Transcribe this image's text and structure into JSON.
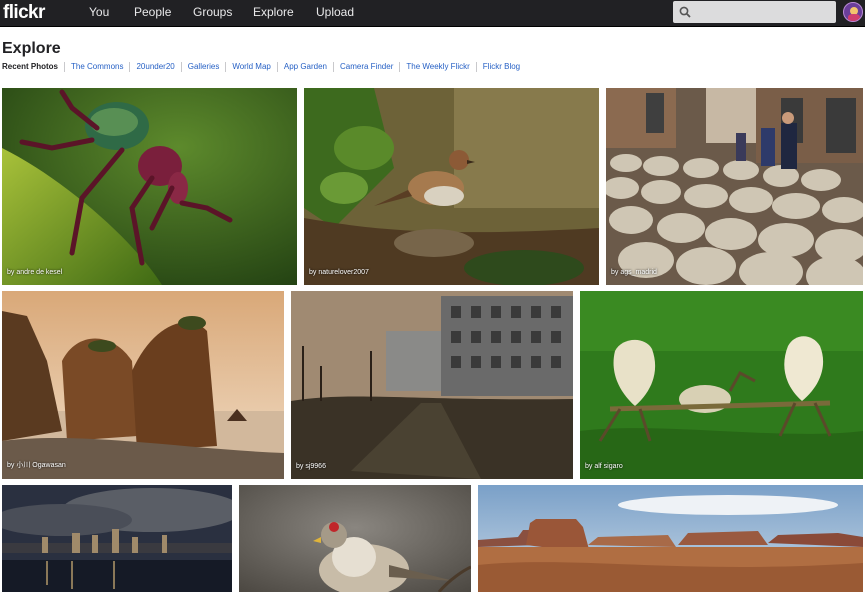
{
  "nav": {
    "logo": "flickr",
    "links": [
      "You",
      "People",
      "Groups",
      "Explore",
      "Upload"
    ]
  },
  "search": {
    "placeholder": ""
  },
  "page": {
    "title": "Explore",
    "subnav": [
      "Recent Photos",
      "The Commons",
      "20under20",
      "Galleries",
      "World Map",
      "App Garden",
      "Camera Finder",
      "The Weekly Flickr",
      "Flickr Blog"
    ]
  },
  "photos": [
    {
      "byline": "by andre de kesel",
      "subject": "weevil beetle on leaf"
    },
    {
      "byline": "by naturelover2007",
      "subject": "sparrow on forest floor"
    },
    {
      "byline": "by ags_madrid",
      "subject": "flock of sheep in city street"
    },
    {
      "byline": "by 小川 Ogawasan",
      "subject": "coastal rock formations at sunset"
    },
    {
      "byline": "by sj9966",
      "subject": "abandoned buildings"
    },
    {
      "byline": "by alf sigaro",
      "subject": "gourd sculptures on grass"
    },
    {
      "byline": "",
      "subject": "city skyline at night"
    },
    {
      "byline": "",
      "subject": "redpoll bird on branch"
    },
    {
      "byline": "",
      "subject": "desert mesas landscape"
    }
  ],
  "colors": {
    "topbar": "#212124",
    "link": "#2761c5"
  }
}
